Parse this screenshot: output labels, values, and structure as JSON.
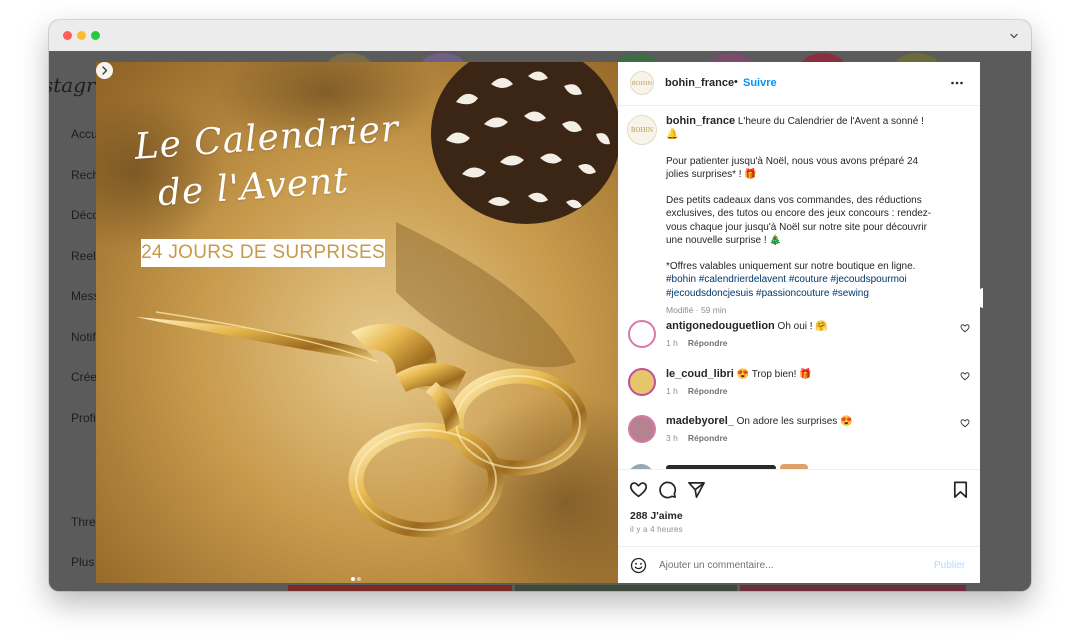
{
  "window": {
    "traffic_lights": [
      "close",
      "minimize",
      "zoom"
    ],
    "chevron_icon": "chevron-down-icon"
  },
  "background_page": {
    "logo": "stagra",
    "nav": [
      {
        "label": "Accue",
        "icon": "home-icon"
      },
      {
        "label": "Reche",
        "icon": "search-icon"
      },
      {
        "label": "Décou",
        "icon": "compass-icon"
      },
      {
        "label": "Reels",
        "icon": "reels-icon"
      },
      {
        "label": "Messa",
        "icon": "messages-icon"
      },
      {
        "label": "Notific",
        "icon": "heart-icon"
      },
      {
        "label": "Créer",
        "icon": "plus-icon"
      },
      {
        "label": "Profil",
        "icon": "profile-icon"
      },
      {
        "label": "Threac",
        "icon": "threads-icon"
      },
      {
        "label": "Plus",
        "icon": "menu-icon"
      }
    ]
  },
  "post": {
    "image": {
      "script_title_line1": "Le Calendrier",
      "script_title_line2": "de l'Avent",
      "banner": "24 JOURS DE SURPRISES",
      "carousel_index": 1,
      "carousel_count": 2,
      "colors": {
        "gold": "#c69a48",
        "background": "#b78b34"
      }
    },
    "header": {
      "avatar_text": "BOHIN",
      "username": "bohin_france",
      "separator": "•",
      "follow": "Suivre",
      "more_icon": "more-horizontal-icon"
    },
    "caption": {
      "username": "bohin_france",
      "line1": "L'heure du Calendrier de l'Avent a sonné ! 🔔",
      "para2": "Pour patienter jusqu'à Noël, nous vous avons préparé 24 jolies surprises* ! 🎁",
      "para3": "Des petits cadeaux dans vos commandes, des réductions exclusives, des tutos ou encore des jeux concours : rendez-vous chaque jour jusqu'à Noël sur notre site pour découvrir une nouvelle surprise ! 🎄",
      "para4": "*Offres valables uniquement sur notre boutique en ligne.",
      "hashtags": "#bohin #calendrierdelavent #couture #jecoudspourmoi #jecoudsdoncjesuis #passioncouture #sewing",
      "meta": "Modifié · 59 min"
    },
    "comments": [
      {
        "user": "antigonedouguetlion",
        "text": "Oh oui ! 🤗",
        "time": "1 h",
        "reply": "Répondre"
      },
      {
        "user": "le_coud_libri",
        "text": "😍 Trop bien! 🎁",
        "time": "1 h",
        "reply": "Répondre"
      },
      {
        "user": "madebyorel_",
        "text": "On adore les surprises 😍",
        "time": "3 h",
        "reply": "Répondre"
      }
    ],
    "actions": {
      "like_icon": "heart-icon",
      "comment_icon": "comment-icon",
      "share_icon": "share-icon",
      "save_icon": "bookmark-icon"
    },
    "likes": "288 J'aime",
    "posted": "il y a 4 heures",
    "add_comment": {
      "placeholder": "Ajouter un commentaire...",
      "publish": "Publier",
      "emoji_icon": "emoji-icon"
    }
  }
}
